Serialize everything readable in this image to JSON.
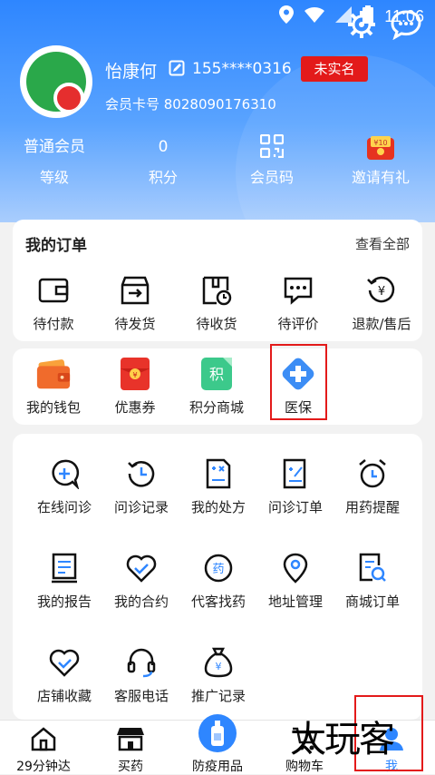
{
  "status_bar": {
    "time": "11:06"
  },
  "profile": {
    "name": "怡康何",
    "phone": "155****0316",
    "badge": "未实名",
    "member_card": "会员卡号 8028090176310"
  },
  "stats": [
    {
      "value": "普通会员",
      "label": "等级"
    },
    {
      "value": "0",
      "label": "积分"
    },
    {
      "value": "",
      "label": "会员码"
    },
    {
      "value": "",
      "label": "邀请有礼"
    }
  ],
  "orders": {
    "title": "我的订单",
    "view_all": "查看全部",
    "items": [
      "待付款",
      "待发货",
      "待收货",
      "待评价",
      "退款/售后"
    ]
  },
  "wallet_row": [
    "我的钱包",
    "优惠券",
    "积分商城",
    "医保"
  ],
  "services": [
    "在线问诊",
    "问诊记录",
    "我的处方",
    "问诊订单",
    "用药提醒",
    "我的报告",
    "我的合约",
    "代客找药",
    "地址管理",
    "商城订单",
    "店铺收藏",
    "客服电话",
    "推广记录"
  ],
  "tabs": [
    "29分钟达",
    "买药",
    "防疫用品",
    "购物车",
    "我"
  ],
  "watermark": "太玩客",
  "colors": {
    "accent": "#2e86ff",
    "alert": "#e31a1a",
    "active_tab": "#2e86ff"
  }
}
